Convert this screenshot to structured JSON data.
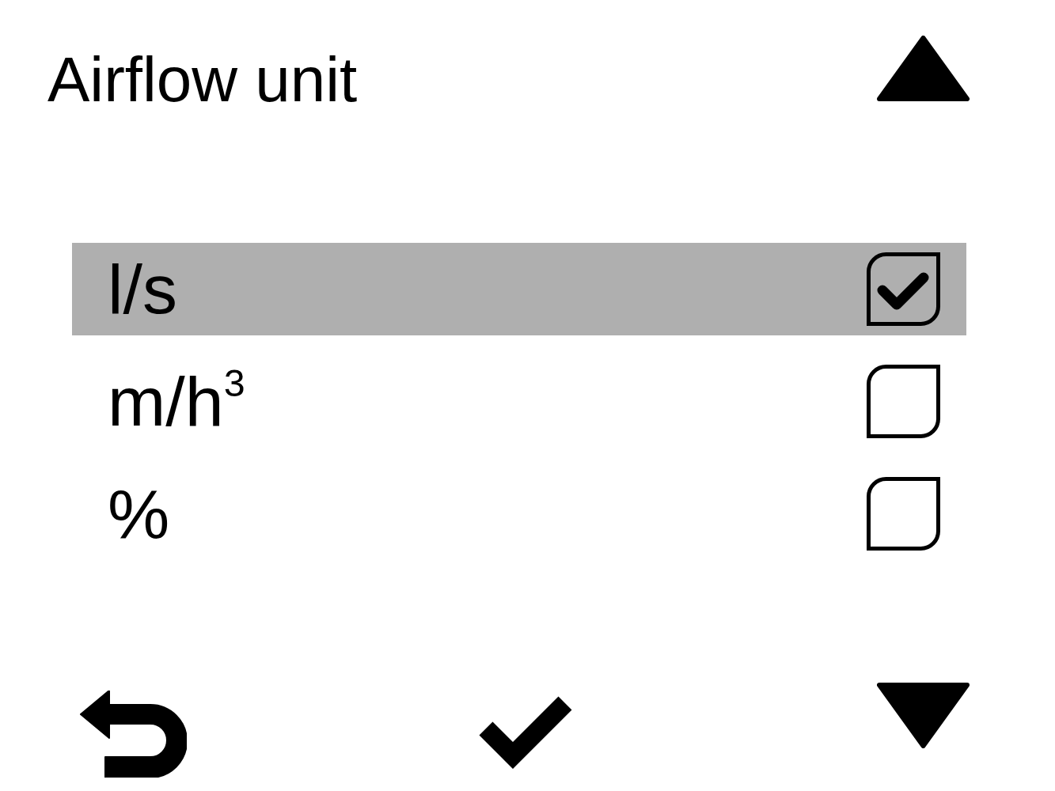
{
  "title": "Airflow unit",
  "options": [
    {
      "label": "l/s",
      "selected": true,
      "checked": true
    },
    {
      "label": "m/h$^{3}$",
      "selected": false,
      "checked": false
    },
    {
      "label": "%",
      "selected": false,
      "checked": false
    }
  ]
}
